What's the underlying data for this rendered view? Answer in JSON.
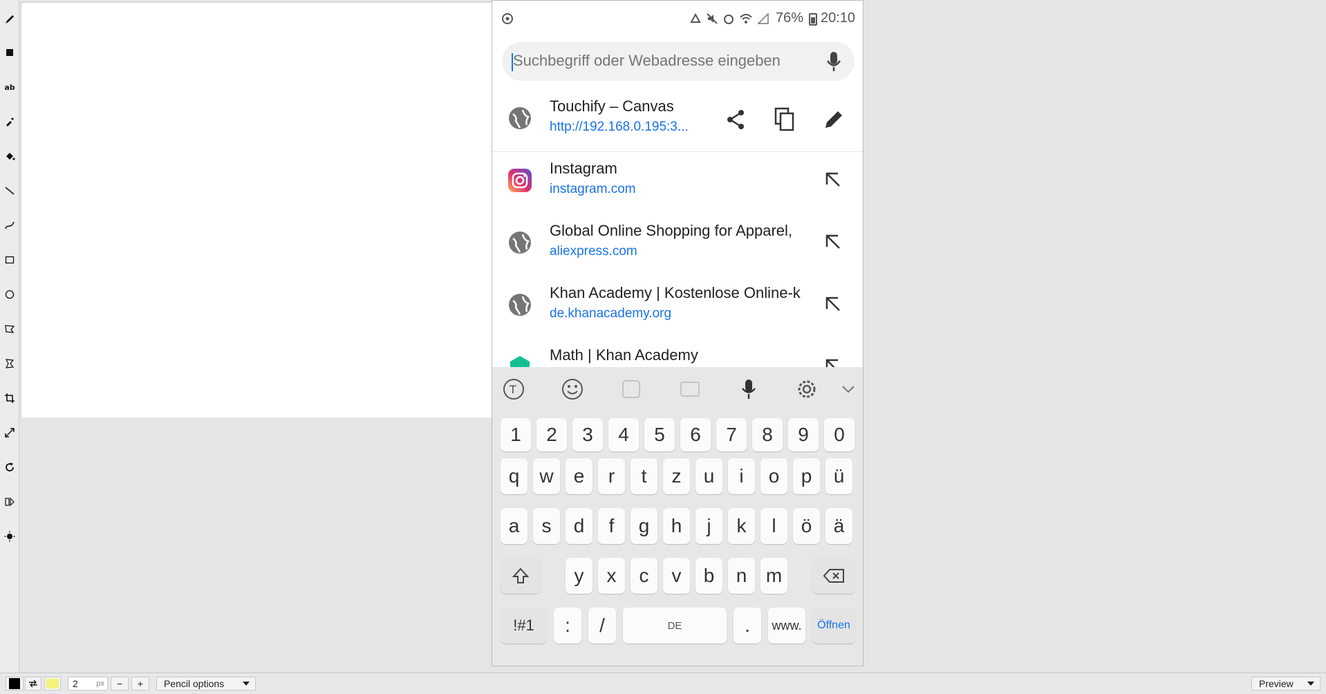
{
  "toolbar": {
    "tools": [
      {
        "icon": "pencil-icon"
      },
      {
        "icon": "square-fill-icon"
      },
      {
        "icon": "text-icon",
        "glyph": "ab"
      },
      {
        "icon": "dropper-icon"
      },
      {
        "icon": "fill-bucket-icon"
      },
      {
        "icon": "line-icon"
      },
      {
        "icon": "curve-icon"
      },
      {
        "icon": "rectangle-icon"
      },
      {
        "icon": "ellipse-icon"
      },
      {
        "icon": "polygon-icon"
      },
      {
        "icon": "select-icon"
      },
      {
        "icon": "crop-icon"
      },
      {
        "icon": "resize-icon"
      },
      {
        "icon": "rotate-icon"
      },
      {
        "icon": "flip-icon"
      },
      {
        "icon": "brightness-icon"
      }
    ]
  },
  "statusbar": {
    "primary_color": "#000000",
    "secondary_color": "#f3f37a",
    "size_value": "2",
    "size_unit": "px",
    "minus": "−",
    "plus": "+",
    "tool_options": "Pencil options",
    "preview": "Preview"
  },
  "phone": {
    "status": {
      "battery": "76%",
      "time": "20:10"
    },
    "search": {
      "placeholder": "Suchbegriff oder Webadresse eingeben"
    },
    "current": {
      "title": "Touchify – Canvas",
      "url": "http://192.168.0.195:3..."
    },
    "suggestions": [
      {
        "title": "Instagram",
        "url": "instagram.com",
        "icon": "instagram-icon"
      },
      {
        "title": "Global Online Shopping for Apparel,",
        "url": "aliexpress.com",
        "icon": "globe-icon"
      },
      {
        "title": "Khan Academy | Kostenlose Online-k",
        "url": "de.khanacademy.org",
        "icon": "globe-icon"
      },
      {
        "title": "Math | Khan Academy",
        "url": "",
        "icon": "khan-academy-icon"
      }
    ],
    "keyboard": {
      "numbers": [
        "1",
        "2",
        "3",
        "4",
        "5",
        "6",
        "7",
        "8",
        "9",
        "0"
      ],
      "row1": [
        "q",
        "w",
        "e",
        "r",
        "t",
        "z",
        "u",
        "i",
        "o",
        "p",
        "ü"
      ],
      "row2": [
        "a",
        "s",
        "d",
        "f",
        "g",
        "h",
        "j",
        "k",
        "l",
        "ö",
        "ä"
      ],
      "row3": [
        "y",
        "x",
        "c",
        "v",
        "b",
        "n",
        "m"
      ],
      "sym": "!#1",
      "colon": ":",
      "slash": "/",
      "space_label": "DE",
      "dot": ".",
      "www": "www.",
      "enter": "Öffnen"
    }
  }
}
